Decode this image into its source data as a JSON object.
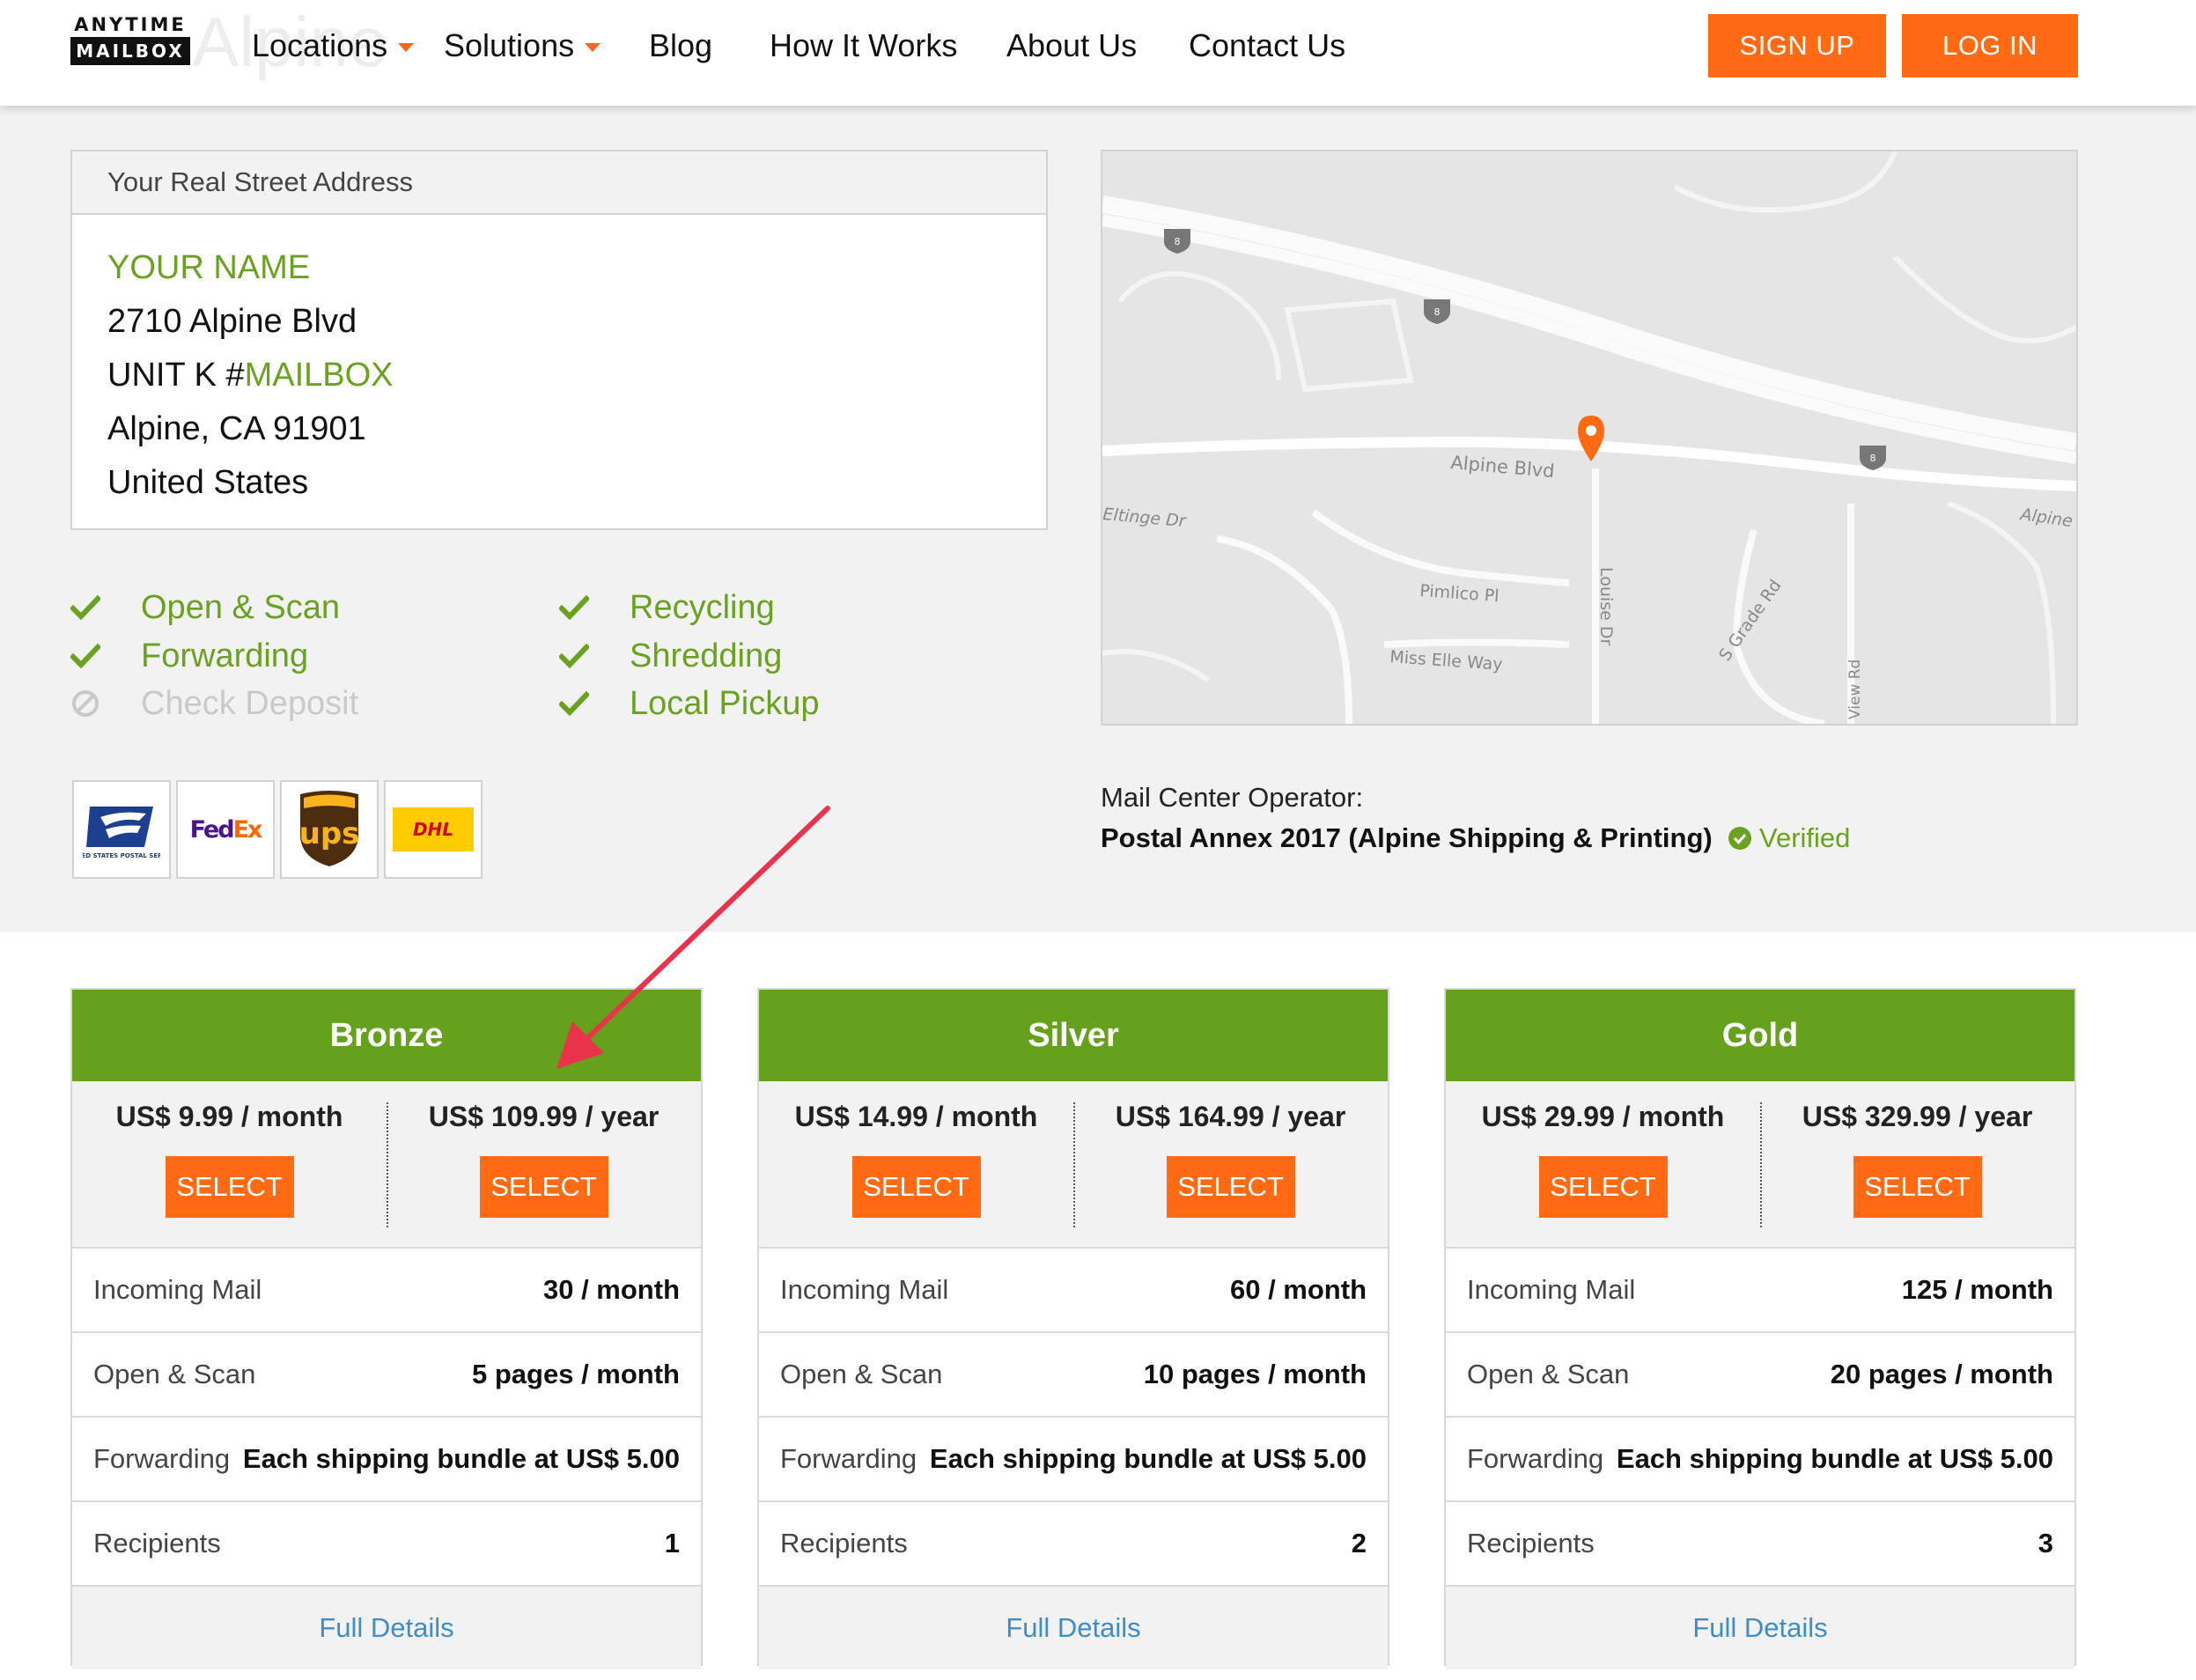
{
  "header": {
    "logo_top": "ANYTIME",
    "logo_bottom": "MAILBOX",
    "ghost_text": "Alpine",
    "nav": {
      "locations": "Locations",
      "solutions": "Solutions",
      "blog": "Blog",
      "how_it_works": "How It Works",
      "about_us": "About Us",
      "contact_us": "Contact Us"
    },
    "sign_up": "SIGN UP",
    "log_in": "LOG IN"
  },
  "address": {
    "heading": "Your Real Street Address",
    "name": "YOUR NAME",
    "line1": "2710 Alpine Blvd",
    "unit_prefix": "UNIT K #",
    "unit_mailbox": "MAILBOX",
    "city": "Alpine, CA 91901",
    "country": "United States"
  },
  "features": {
    "open_scan": "Open & Scan",
    "forwarding": "Forwarding",
    "check_deposit": "Check Deposit",
    "recycling": "Recycling",
    "shredding": "Shredding",
    "local_pickup": "Local Pickup"
  },
  "carriers": {
    "usps": "UNITED STATES POSTAL SERVICE",
    "fedex": "FedEx",
    "ups": "ups",
    "dhl": "DHL"
  },
  "map": {
    "alpine_blvd": "Alpine Blvd",
    "eltinge": "Eltinge Dr",
    "alpine": "Alpine",
    "pimlico": "Pimlico Pl",
    "louise": "Louise Dr",
    "miss_elle": "Miss Elle Way",
    "grade": "S Grade Rd",
    "view_rd": "View Rd",
    "interstate": "8"
  },
  "operator": {
    "label": "Mail Center Operator:",
    "name": "Postal Annex 2017 (Alpine Shipping & Printing)",
    "verified": "Verified"
  },
  "plans": [
    {
      "name": "Bronze",
      "monthly": "US$ 9.99 / month",
      "yearly": "US$ 109.99 / year",
      "select": "SELECT",
      "incoming_label": "Incoming Mail",
      "incoming": "30 / month",
      "scan_label": "Open & Scan",
      "scan": "5 pages / month",
      "fwd_label": "Forwarding",
      "fwd": "Each shipping bundle at US$ 5.00",
      "rec_label": "Recipients",
      "rec": "1",
      "details": "Full Details"
    },
    {
      "name": "Silver",
      "monthly": "US$ 14.99 / month",
      "yearly": "US$ 164.99 / year",
      "select": "SELECT",
      "incoming_label": "Incoming Mail",
      "incoming": "60 / month",
      "scan_label": "Open & Scan",
      "scan": "10 pages / month",
      "fwd_label": "Forwarding",
      "fwd": "Each shipping bundle at US$ 5.00",
      "rec_label": "Recipients",
      "rec": "2",
      "details": "Full Details"
    },
    {
      "name": "Gold",
      "monthly": "US$ 29.99 / month",
      "yearly": "US$ 329.99 / year",
      "select": "SELECT",
      "incoming_label": "Incoming Mail",
      "incoming": "125 / month",
      "scan_label": "Open & Scan",
      "scan": "20 pages / month",
      "fwd_label": "Forwarding",
      "fwd": "Each shipping bundle at US$ 5.00",
      "rec_label": "Recipients",
      "rec": "3",
      "details": "Full Details"
    }
  ],
  "colors": {
    "accent_orange": "#ff6a13",
    "plan_green": "#66a11e",
    "feature_green": "#6aa121",
    "link_blue": "#3c8dcb",
    "annotation_red": "#e8334a"
  },
  "icons": {
    "check": "check-icon",
    "disabled": "disabled-icon",
    "map_pin": "map-pin-icon",
    "verified": "verified-check-icon"
  }
}
